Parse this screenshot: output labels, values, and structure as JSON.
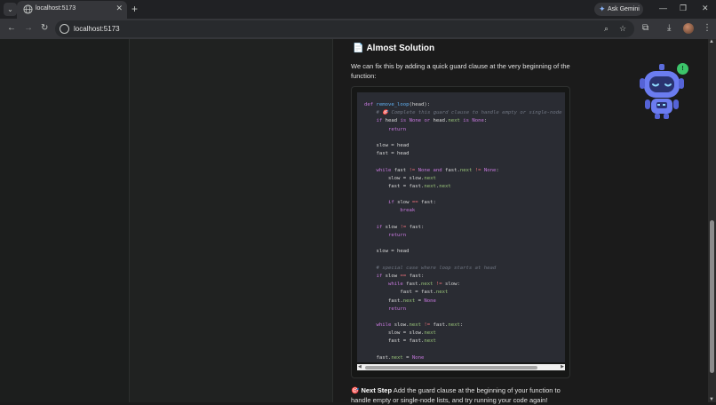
{
  "browser": {
    "tab_title": "localhost:5173",
    "tab_close": "✕",
    "new_tab": "+",
    "ask_gemini": "Ask Gemini",
    "url": "localhost:5173",
    "window_minimize": "—",
    "window_restore": "❐",
    "window_close": "✕"
  },
  "content": {
    "section_title": "Almost Solution",
    "section_emoji": "📄",
    "description": "We can fix this by adding a quick guard clause at the very beginning of the function:",
    "next_step_emoji": "🎯",
    "next_step_label": "Next Step",
    "next_step_text": " Add the guard clause at the beginning of your function to handle empty or single-node lists, and try running your code again!"
  },
  "code": [
    "def remove_loop(head):",
    "    # 🎯 Complete this guard clause to handle empty or single-node",
    "    if head is None or head.next is None:",
    "        return",
    "",
    "    slow = head",
    "    fast = head",
    "",
    "    while fast != None and fast.next != None:",
    "        slow = slow.next",
    "        fast = fast.next.next",
    "",
    "        if slow == fast:",
    "            break",
    "",
    "    if slow != fast:",
    "        return",
    "",
    "    slow = head",
    "",
    "    # special case where loop starts at head",
    "    if slow == fast:",
    "        while fast.next != slow:",
    "            fast = fast.next",
    "        fast.next = None",
    "        return",
    "",
    "    while slow.next != fast.next:",
    "        slow = slow.next",
    "        fast = fast.next",
    "",
    "    fast.next = None"
  ],
  "notification_badge": "!",
  "colors": {
    "accent_green": "#3cc46a",
    "robot_blue": "#6b7cf0"
  }
}
